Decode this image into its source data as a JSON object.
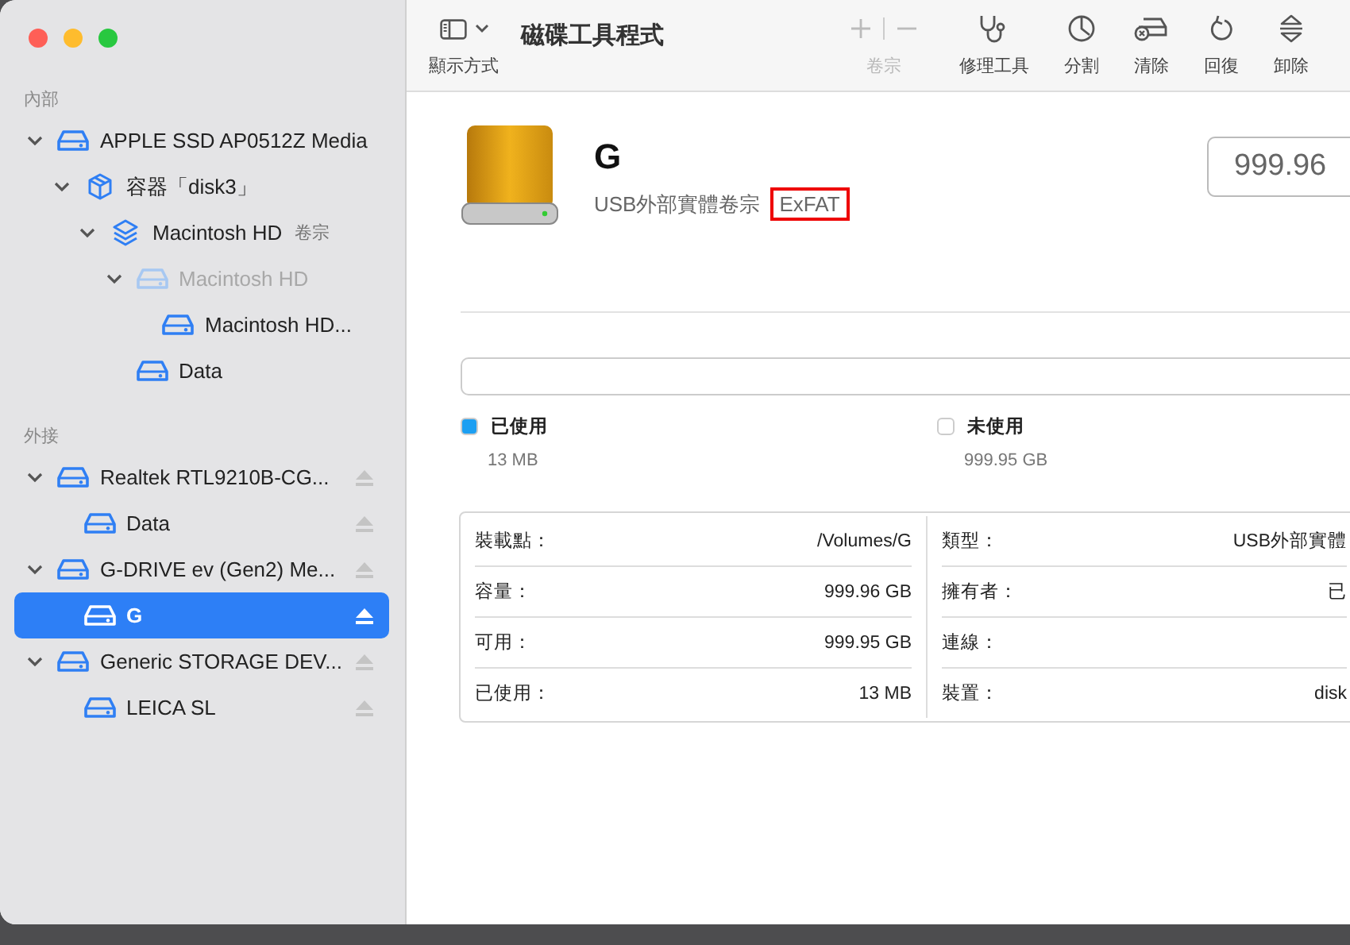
{
  "window": {
    "title": "磁碟工具程式",
    "controls": [
      {
        "kind": "close"
      },
      {
        "kind": "minimize"
      },
      {
        "kind": "zoom"
      }
    ]
  },
  "toolbar": {
    "view_label": "顯示方式",
    "volume_label": "卷宗",
    "volume_disabled": true,
    "actions": [
      {
        "kind": "repair",
        "label": "修理工具",
        "disabled": false
      },
      {
        "kind": "partition",
        "label": "分割",
        "disabled": false
      },
      {
        "kind": "erase",
        "label": "清除",
        "disabled": false
      },
      {
        "kind": "restore",
        "label": "回復",
        "disabled": false
      },
      {
        "kind": "unmount",
        "label": "卸除",
        "disabled": false
      }
    ]
  },
  "sidebar": {
    "sections": [
      {
        "title": "內部",
        "items": [
          {
            "label": "APPLE SSD AP0512Z Media",
            "kind": "drive",
            "muted": false,
            "selected": false,
            "eject": false,
            "expanded": true,
            "children": [
              {
                "label": "容器「disk3」",
                "kind": "container",
                "muted": false,
                "selected": false,
                "eject": false,
                "expanded": true,
                "children": [
                  {
                    "label": "Macintosh HD",
                    "suffix": "卷宗",
                    "kind": "layers",
                    "muted": false,
                    "selected": false,
                    "eject": false,
                    "expanded": true,
                    "children": [
                      {
                        "label": "Macintosh HD",
                        "kind": "drive",
                        "muted": true,
                        "selected": false,
                        "eject": false,
                        "expanded": true,
                        "children": [
                          {
                            "label": "Macintosh HD...",
                            "kind": "drive",
                            "muted": false,
                            "selected": false,
                            "eject": false
                          }
                        ]
                      },
                      {
                        "label": "Data",
                        "kind": "drive",
                        "muted": false,
                        "selected": false,
                        "eject": false
                      }
                    ]
                  }
                ]
              }
            ]
          }
        ]
      },
      {
        "title": "外接",
        "items": [
          {
            "label": "Realtek RTL9210B-CG...",
            "kind": "drive",
            "muted": false,
            "selected": false,
            "eject": true,
            "expanded": true,
            "children": [
              {
                "label": "Data",
                "kind": "drive",
                "muted": false,
                "selected": false,
                "eject": true
              }
            ]
          },
          {
            "label": "G-DRIVE ev (Gen2) Me...",
            "kind": "drive",
            "muted": false,
            "selected": false,
            "eject": true,
            "expanded": true,
            "children": [
              {
                "label": "G",
                "kind": "drive",
                "muted": false,
                "selected": true,
                "eject": true
              }
            ]
          },
          {
            "label": "Generic STORAGE DEV...",
            "kind": "drive",
            "muted": false,
            "selected": false,
            "eject": true,
            "expanded": true,
            "children": [
              {
                "label": "LEICA SL",
                "kind": "drive",
                "muted": false,
                "selected": false,
                "eject": true
              }
            ]
          }
        ]
      }
    ]
  },
  "volume": {
    "name": "G",
    "subtitle": "USB外部實體卷宗",
    "format": "ExFAT",
    "format_highlighted": true,
    "capacity": "999.96"
  },
  "usage": {
    "level": 0,
    "legend": [
      {
        "label": "已使用",
        "value": "13 MB",
        "color": "#1c9ff2"
      },
      {
        "label": "未使用",
        "value": "999.95 GB",
        "color": "#ffffff"
      }
    ]
  },
  "info": {
    "left": [
      {
        "label": "裝載點：",
        "value": "/Volumes/G"
      },
      {
        "label": "容量：",
        "value": "999.96 GB"
      },
      {
        "label": "可用：",
        "value": "999.95 GB"
      },
      {
        "label": "已使用：",
        "value": "13 MB"
      }
    ],
    "right": [
      {
        "label": "類型：",
        "value": "USB外部實體"
      },
      {
        "label": "擁有者：",
        "value": "已"
      },
      {
        "label": "連線："
      },
      {
        "label": "裝置：",
        "value": "disk"
      }
    ]
  }
}
